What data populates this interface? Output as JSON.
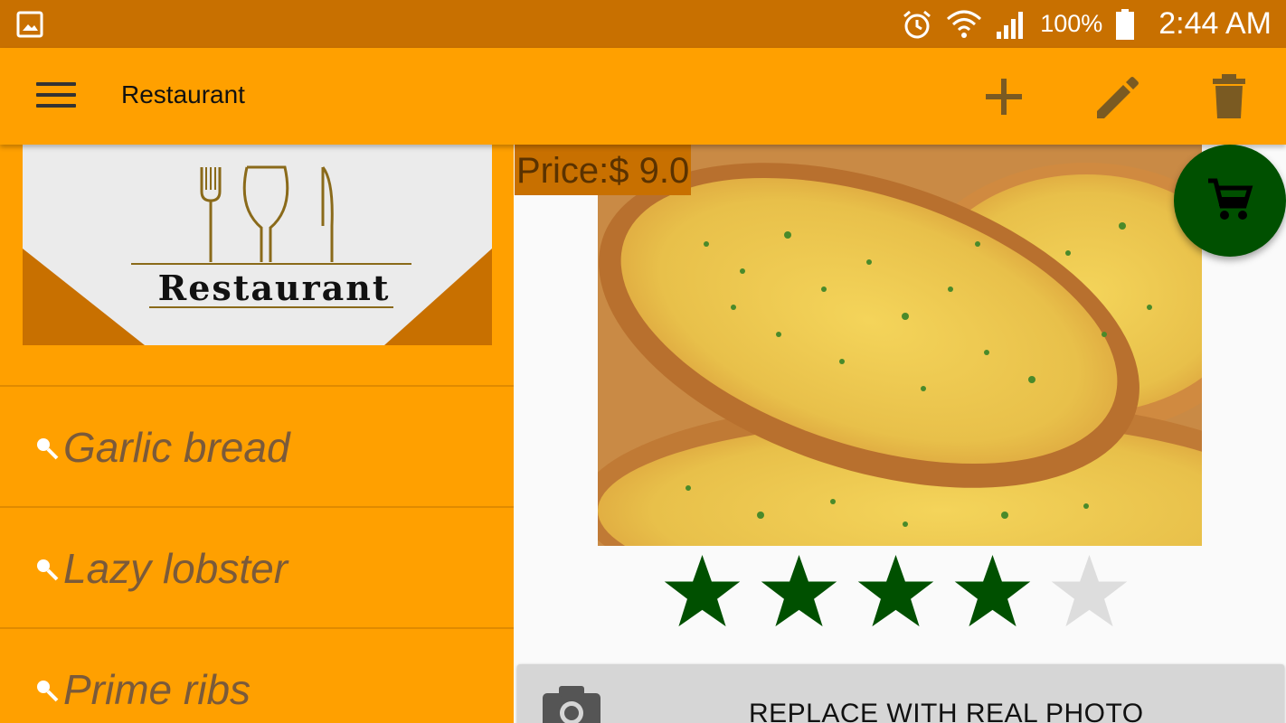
{
  "status_bar": {
    "battery_percent": "100%",
    "time": "2:44 AM",
    "icons": [
      "gallery-icon",
      "alarm-icon",
      "wifi-icon",
      "signal-icon",
      "battery-icon"
    ]
  },
  "toolbar": {
    "title": "Restaurant",
    "actions": [
      "add-icon",
      "edit-icon",
      "delete-icon"
    ]
  },
  "drawer": {
    "logo_text": "Restaurant",
    "items": [
      {
        "label": "Garlic bread"
      },
      {
        "label": "Lazy lobster"
      },
      {
        "label": "Prime ribs"
      }
    ]
  },
  "detail": {
    "price": "Price:$ 9.0",
    "rating": 4,
    "rating_max": 5,
    "photo_button_label": "REPLACE WITH REAL PHOTO"
  },
  "colors": {
    "status_bar": "#c87000",
    "toolbar": "#ffa000",
    "fab": "#005000",
    "star_filled": "#005000",
    "star_empty": "#dddddd"
  }
}
